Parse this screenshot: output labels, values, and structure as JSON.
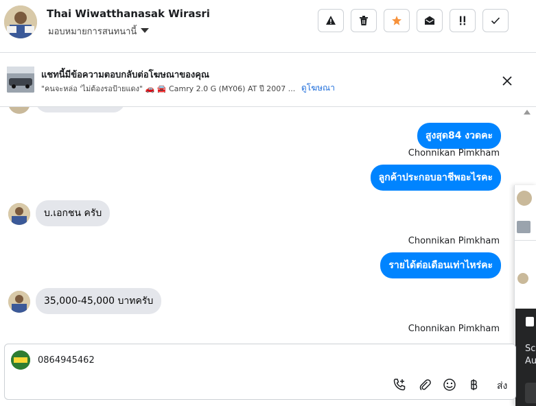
{
  "header": {
    "name": "Thai Wiwatthanasak Wirasri",
    "assign_label": "มอบหมายการสนทนานี้",
    "toolbar": [
      {
        "name": "spam-button",
        "icon": "warning-icon"
      },
      {
        "name": "delete-button",
        "icon": "trash-icon"
      },
      {
        "name": "star-button",
        "icon": "star-icon"
      },
      {
        "name": "mark-unread-button",
        "icon": "envelope-open-icon"
      },
      {
        "name": "follow-up-button",
        "icon": "priority-icon"
      },
      {
        "name": "done-button",
        "icon": "check-icon"
      }
    ],
    "star_color": "#f7923b"
  },
  "ad_banner": {
    "title": "แชทนี้มีข้อความตอบกลับต่อโฆษณาของคุณ",
    "desc": "\"คนจะหล่อ 'ไม่ต้องรอป้ายแดง\" 🚗 🚘 Camry 2.0 G (MY06) AT ปี 2007 ...",
    "link": "ดูโฆษณา"
  },
  "messages": [
    {
      "type": "out",
      "text": "สูงสุด84 งวดคะ"
    },
    {
      "type": "sender",
      "text": "Chonnikan Pimkham"
    },
    {
      "type": "out",
      "text": "ลูกค้าประกอบอาชีพอะไรคะ"
    },
    {
      "type": "in",
      "text": "บ.เอกชน ครับ"
    },
    {
      "type": "sender",
      "text": "Chonnikan Pimkham"
    },
    {
      "type": "out",
      "text": "รายได้ต่อเดือนเท่าไหร่คะ"
    },
    {
      "type": "in",
      "text": "35,000-45,000 บาทครับ"
    },
    {
      "type": "sender",
      "text": "Chonnikan Pimkham"
    }
  ],
  "composer": {
    "text": "0864945462",
    "send_label": "ส่ง"
  },
  "side_panel": {
    "line1": "Sc",
    "line2": "Au"
  },
  "colors": {
    "accent": "#0084ff",
    "incoming": "#e4e6eb",
    "link": "#216fdb"
  }
}
